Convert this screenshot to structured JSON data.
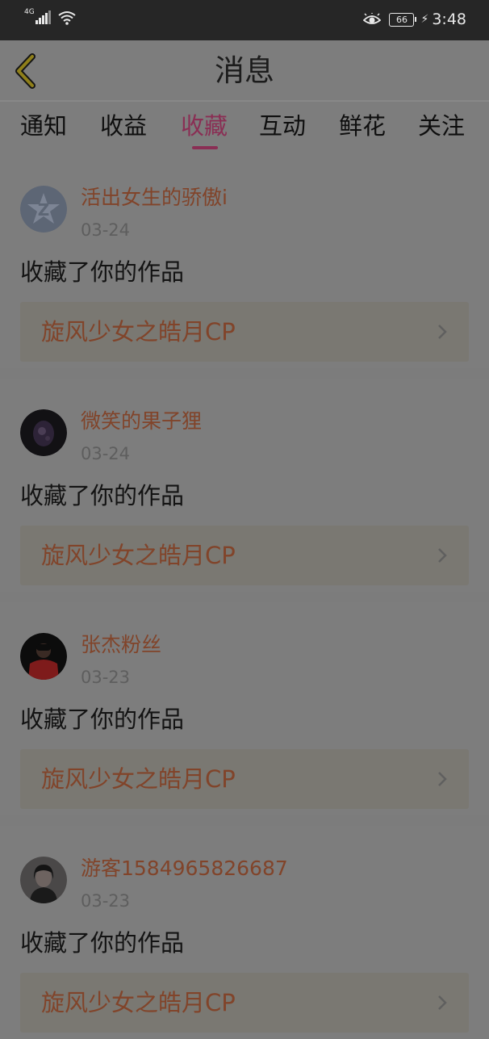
{
  "status_bar": {
    "network": "4G",
    "battery": "66",
    "time": "3:48"
  },
  "header": {
    "title": "消息"
  },
  "tabs": [
    {
      "label": "通知"
    },
    {
      "label": "收益"
    },
    {
      "label": "收藏",
      "active": true
    },
    {
      "label": "互动"
    },
    {
      "label": "鲜花"
    },
    {
      "label": "关注"
    }
  ],
  "feed": [
    {
      "user": "活出女生的骄傲i",
      "date": "03-24",
      "action": "收藏了你的作品",
      "work": "旋风少女之皓月CP",
      "avatar": "default-qq-avatar"
    },
    {
      "user": "微笑的果子狸",
      "date": "03-24",
      "action": "收藏了你的作品",
      "work": "旋风少女之皓月CP",
      "avatar": "dark-photo-avatar"
    },
    {
      "user": "张杰粉丝",
      "date": "03-23",
      "action": "收藏了你的作品",
      "work": "旋风少女之皓月CP",
      "avatar": "red-jacket-avatar"
    },
    {
      "user": "游客1584965826687",
      "date": "03-23",
      "action": "收藏了你的作品",
      "work": "旋风少女之皓月CP",
      "avatar": "girl-portrait-avatar"
    }
  ],
  "colors": {
    "accent": "#8a2e54",
    "username": "#81442a",
    "overlay_background": "#7d7d7d"
  }
}
